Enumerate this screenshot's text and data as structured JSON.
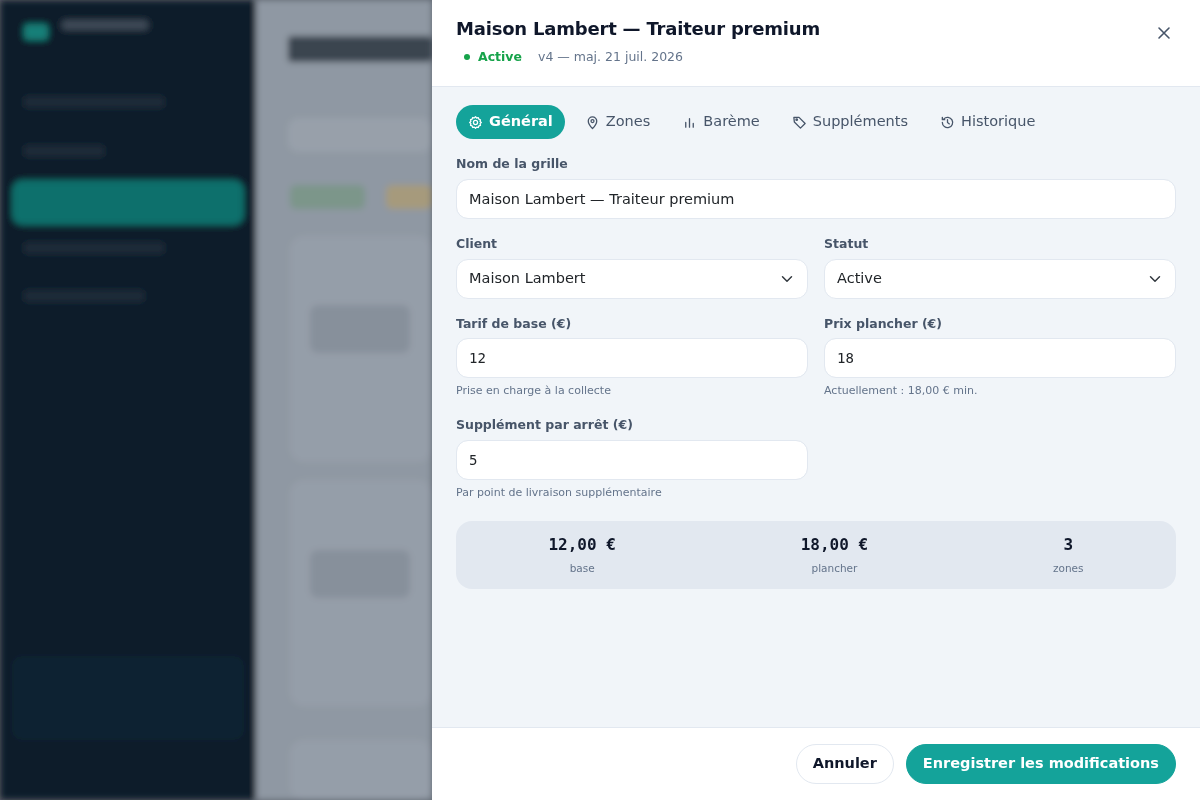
{
  "drawer": {
    "title": "Maison Lambert — Traiteur premium",
    "status": {
      "label": "Active",
      "color": "#16a34a"
    },
    "meta": "v4 — maj. 21 juil. 2026"
  },
  "tabs": [
    {
      "label": "Général",
      "selected": true
    },
    {
      "label": "Zones",
      "selected": false
    },
    {
      "label": "Barème",
      "selected": false
    },
    {
      "label": "Suppléments",
      "selected": false
    },
    {
      "label": "Historique",
      "selected": false
    }
  ],
  "rows": [
    [
      {
        "label": "Nom de la grille",
        "kind": "text",
        "value": "Maison Lambert — Traiteur premium"
      }
    ],
    [
      {
        "label": "Client",
        "kind": "select",
        "value": "Maison Lambert"
      },
      {
        "label": "Statut",
        "kind": "select",
        "value": "Active"
      }
    ],
    [
      {
        "label": "Tarif de base (€)",
        "kind": "number",
        "value": "12",
        "hint": "Prise en charge à la collecte"
      },
      {
        "label": "Prix plancher (€)",
        "kind": "number",
        "value": "18",
        "hint": "Actuellement : 18,00 € min."
      }
    ],
    [
      {
        "label": "Supplément par arrêt (€)",
        "kind": "number",
        "value": "5",
        "hint": "Par point de livraison supplémentaire"
      }
    ]
  ],
  "summary": [
    {
      "value": "12,00 €",
      "label": "base"
    },
    {
      "value": "18,00 €",
      "label": "plancher"
    },
    {
      "value": "3",
      "label": "zones"
    }
  ],
  "buttons": [
    {
      "label": "Annuler",
      "kind": "secondary"
    },
    {
      "label": "Enregistrer les modifications",
      "kind": "primary"
    }
  ]
}
